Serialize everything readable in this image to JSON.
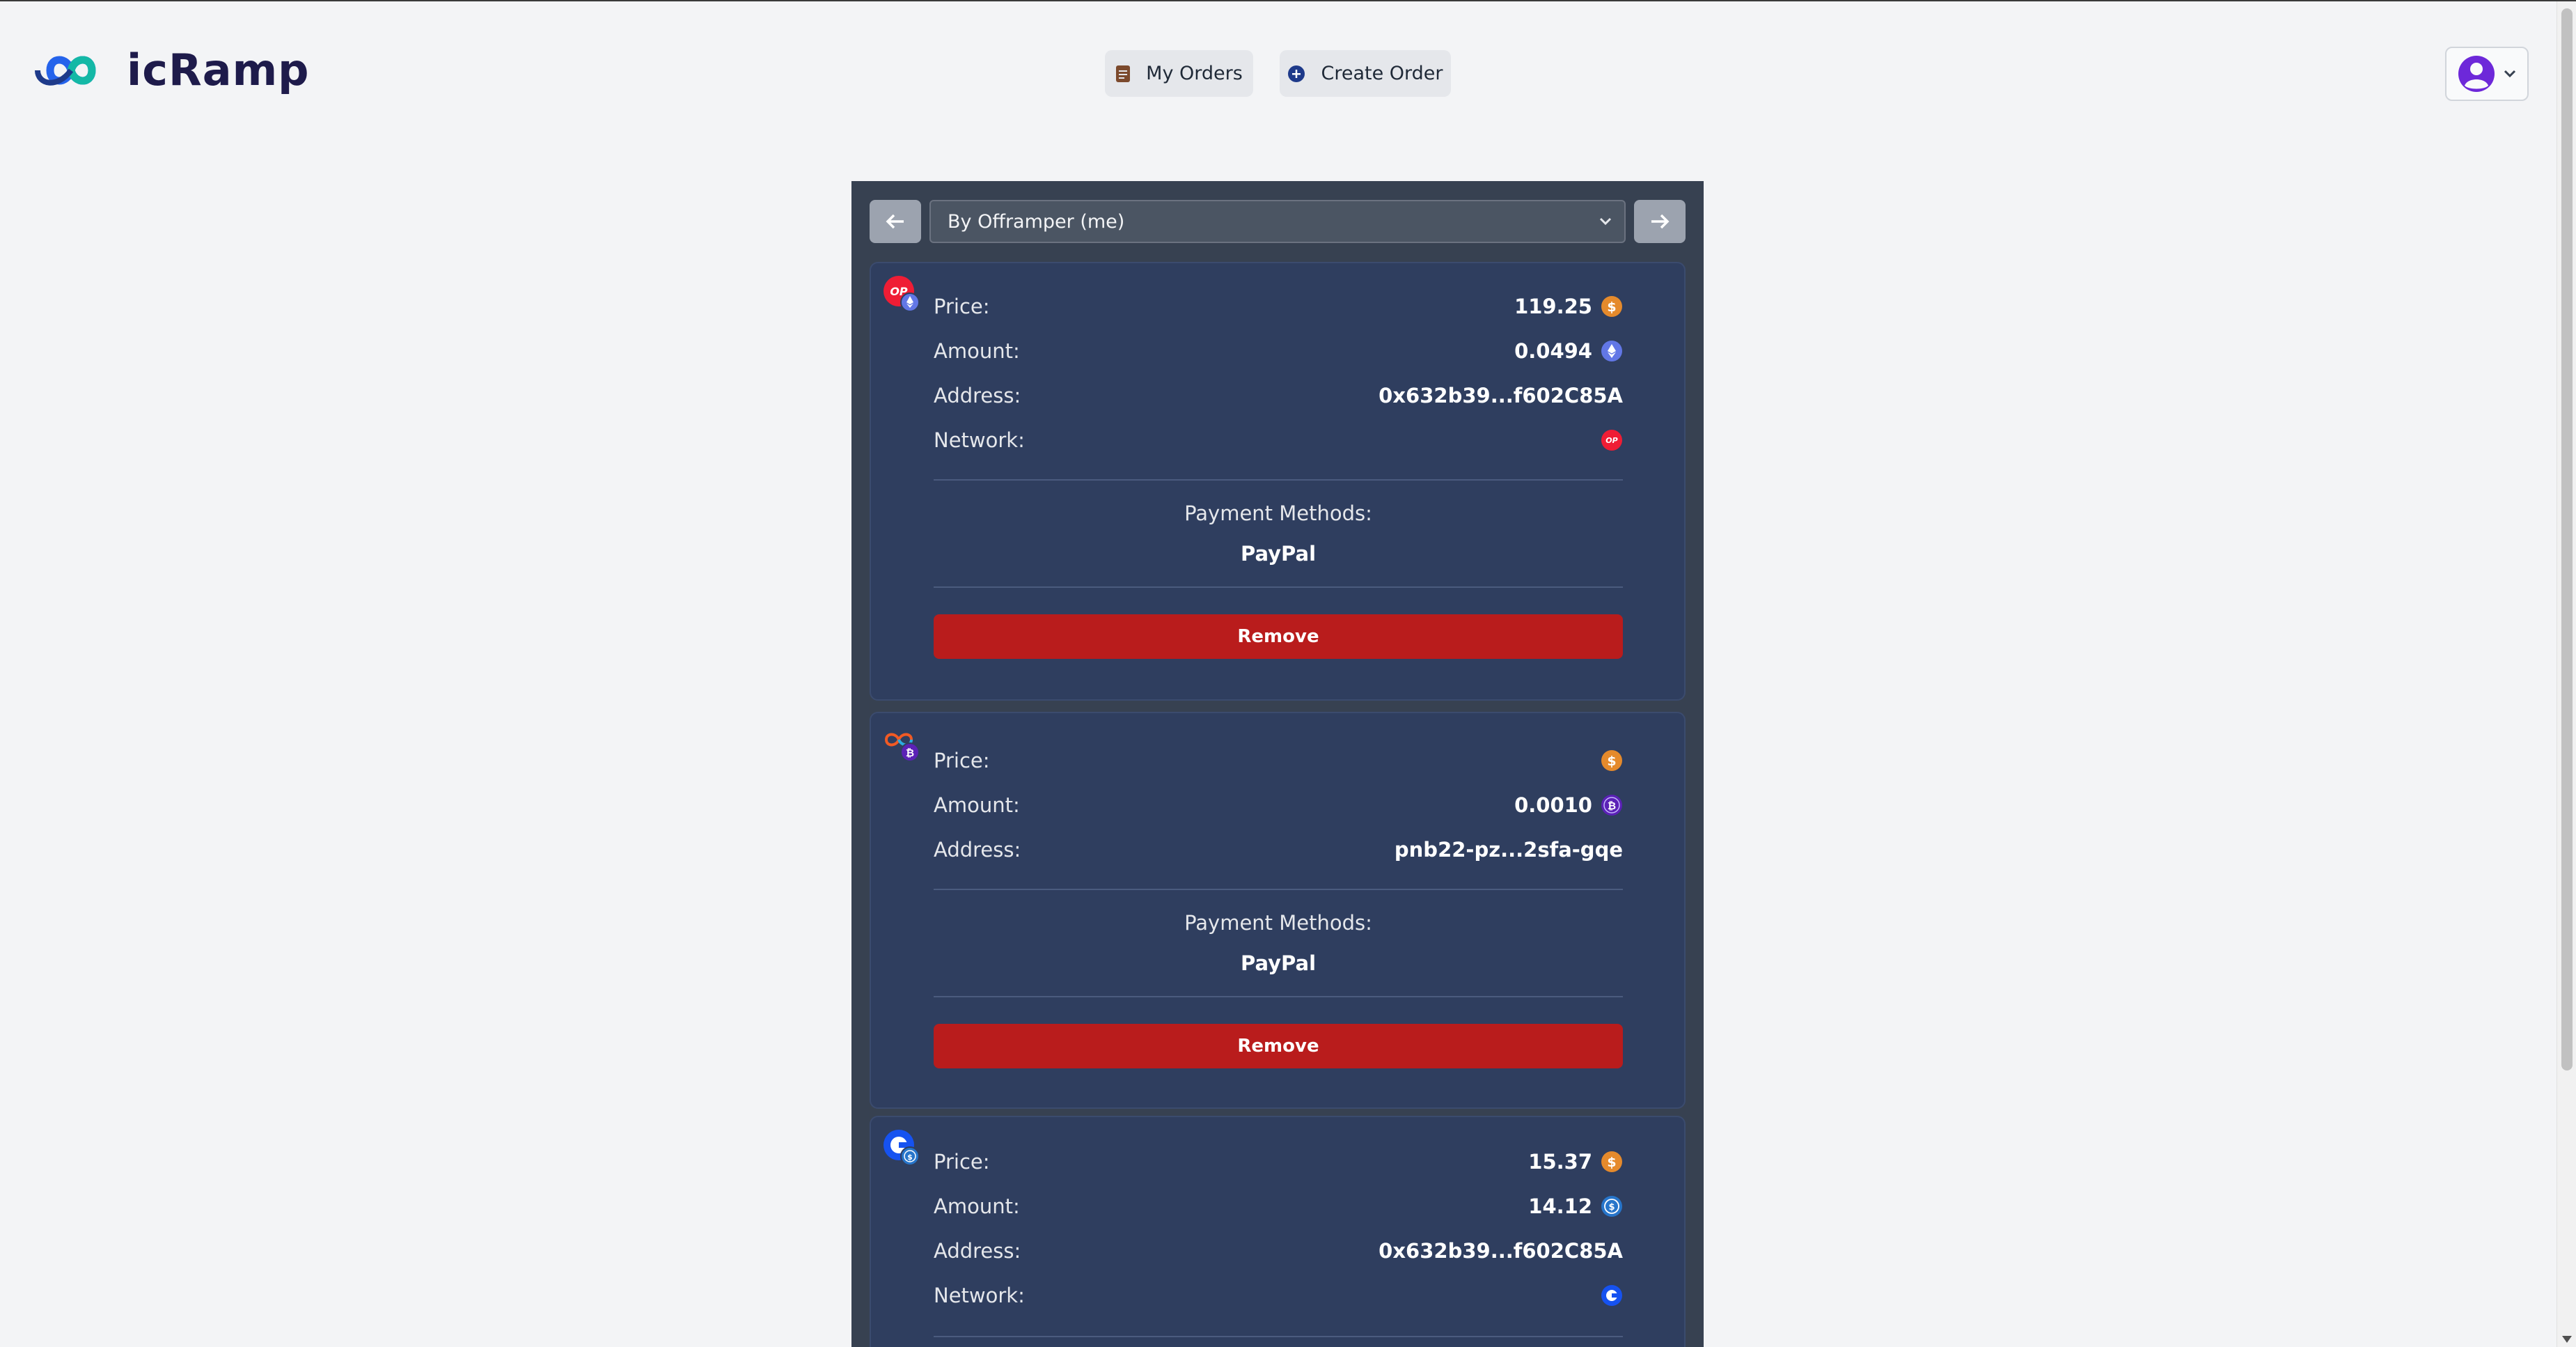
{
  "app": {
    "name": "icRamp"
  },
  "nav": {
    "my_orders": "My Orders",
    "create_order": "Create Order"
  },
  "filter": {
    "selected": "By Offramper (me)"
  },
  "labels": {
    "price": "Price:",
    "amount": "Amount:",
    "address": "Address:",
    "network": "Network:",
    "payment_methods": "Payment Methods:",
    "remove": "Remove"
  },
  "orders": [
    {
      "price": "119.25",
      "amount": "0.0494",
      "address": "0x632b39...f602C85A",
      "network_icon": "optimism-icon",
      "token_icon": "eth-icon",
      "payment_method": "PayPal"
    },
    {
      "price": "",
      "amount": "0.0010",
      "address": "pnb22-pz...2sfa-gqe",
      "network_icon": "icp-icon",
      "token_icon": "ckbtc-icon",
      "payment_method": "PayPal"
    },
    {
      "price": "15.37",
      "amount": "14.12",
      "address": "0x632b39...f602C85A",
      "network_icon": "base-icon",
      "token_icon": "usdc-icon"
    }
  ],
  "colors": {
    "panel": "#374151",
    "card": "#2f3e5f",
    "remove": "#b91c1c",
    "dollar_coin": "#e58a2c"
  }
}
